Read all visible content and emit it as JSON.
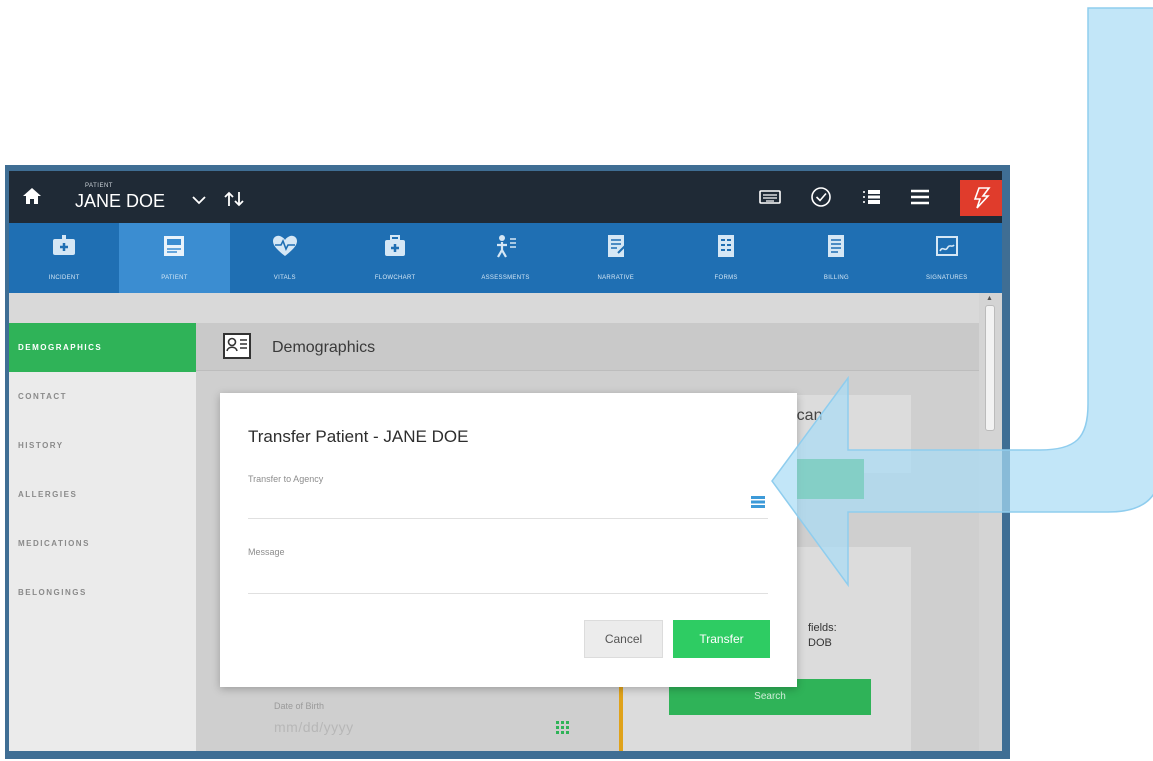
{
  "topbar": {
    "patient_caption": "PATIENT",
    "patient_name": "JANE DOE",
    "icons": [
      "home-icon",
      "chevron-down-icon",
      "sort-icon",
      "keyboard-icon",
      "check-circle-icon",
      "checklist-icon",
      "menu-icon",
      "flash-icon"
    ],
    "flash_color": "#e03c2c"
  },
  "nav_tabs": [
    {
      "label": "INCIDENT",
      "icon": "ambulance-icon"
    },
    {
      "label": "PATIENT",
      "icon": "patient-icon",
      "active": true
    },
    {
      "label": "VITALS",
      "icon": "heartbeat-icon"
    },
    {
      "label": "FLOWCHART",
      "icon": "medkit-icon"
    },
    {
      "label": "ASSESSMENTS",
      "icon": "body-icon"
    },
    {
      "label": "NARRATIVE",
      "icon": "narrative-icon"
    },
    {
      "label": "FORMS",
      "icon": "forms-icon"
    },
    {
      "label": "BILLING",
      "icon": "billing-icon"
    },
    {
      "label": "SIGNATURES",
      "icon": "signature-icon"
    }
  ],
  "sidebar": {
    "items": [
      {
        "label": "DEMOGRAPHICS",
        "active": true
      },
      {
        "label": "CONTACT"
      },
      {
        "label": "HISTORY"
      },
      {
        "label": "ALLERGIES"
      },
      {
        "label": "MEDICATIONS"
      },
      {
        "label": "BELONGINGS"
      }
    ]
  },
  "content": {
    "section_title": "Demographics",
    "scan_text": "Scan",
    "fields_text_1": "fields:",
    "fields_text_2": "DOB",
    "search_label": "Search",
    "dob_label": "Date of Birth",
    "dob_placeholder": "mm/dd/yyyy"
  },
  "modal": {
    "title": "Transfer Patient - JANE DOE",
    "agency_label": "Transfer to Agency",
    "message_label": "Message",
    "cancel_label": "Cancel",
    "transfer_label": "Transfer"
  },
  "colors": {
    "accent_green": "#2fb358",
    "nav_blue": "#1f6fb3",
    "topbar_dark": "#1f2a36",
    "callout_blue": "#a8dcf5"
  }
}
